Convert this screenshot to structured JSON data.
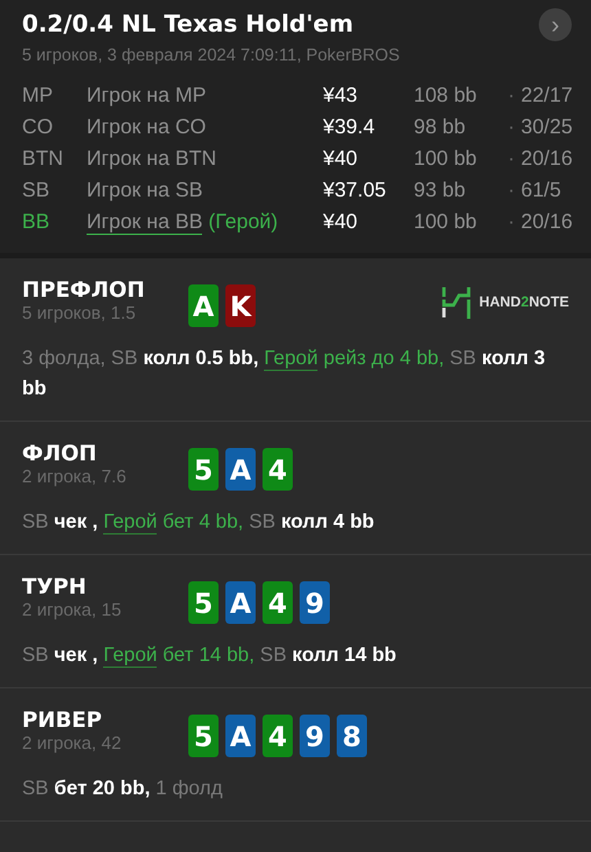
{
  "header": {
    "title": "0.2/0.4 NL Texas Hold'em",
    "subtitle": "5 игроков, 3 февраля 2024 7:09:11, PokerBROS",
    "next_button": "›"
  },
  "players": [
    {
      "position": "MP",
      "name": "Игрок на MP",
      "hero": false,
      "stack": "¥43",
      "bb": "108 bb",
      "separator": "·",
      "stats": "22/17"
    },
    {
      "position": "CO",
      "name": "Игрок на CO",
      "hero": false,
      "stack": "¥39.4",
      "bb": "98 bb",
      "separator": "·",
      "stats": "30/25"
    },
    {
      "position": "BTN",
      "name": "Игрок на BTN",
      "hero": false,
      "stack": "¥40",
      "bb": "100 bb",
      "separator": "·",
      "stats": "20/16"
    },
    {
      "position": "SB",
      "name": "Игрок на SB",
      "hero": false,
      "stack": "¥37.05",
      "bb": "93 bb",
      "separator": "·",
      "stats": "61/5"
    },
    {
      "position": "BB",
      "name": "Игрок на BB",
      "hero": true,
      "hero_tag": "(Герой)",
      "stack": "¥40",
      "bb": "100 bb",
      "separator": "·",
      "stats": "20/16"
    }
  ],
  "streets": [
    {
      "title": "ПРЕФЛОП",
      "info": "5 игроков, 1.5",
      "logo": {
        "before": "HAND",
        "highlight": "2",
        "after": "NOTE"
      },
      "cards": [
        {
          "rank": "A",
          "color": "#0f8a17"
        },
        {
          "rank": "K",
          "color": "#8c0c0c"
        }
      ],
      "actions": [
        {
          "kind": "muted",
          "text": "3 фолда, SB "
        },
        {
          "kind": "action",
          "text": "колл 0.5 bb, "
        },
        {
          "kind": "hero_link",
          "text": "Герой"
        },
        {
          "kind": "hero",
          "text": " рейз до 4 bb, "
        },
        {
          "kind": "muted",
          "text": "SB "
        },
        {
          "kind": "action",
          "text": "колл 3 bb"
        }
      ]
    },
    {
      "title": "ФЛОП",
      "info": "2 игрока, 7.6",
      "cards": [
        {
          "rank": "5",
          "color": "#0f8a17"
        },
        {
          "rank": "A",
          "color": "#1160a8"
        },
        {
          "rank": "4",
          "color": "#0f8a17"
        }
      ],
      "actions": [
        {
          "kind": "muted",
          "text": "SB "
        },
        {
          "kind": "action",
          "text": "чек , "
        },
        {
          "kind": "hero_link",
          "text": "Герой"
        },
        {
          "kind": "hero",
          "text": " бет 4 bb, "
        },
        {
          "kind": "muted",
          "text": "SB "
        },
        {
          "kind": "action",
          "text": "колл 4 bb"
        }
      ]
    },
    {
      "title": "ТУРН",
      "info": "2 игрока, 15",
      "cards": [
        {
          "rank": "5",
          "color": "#0f8a17"
        },
        {
          "rank": "A",
          "color": "#1160a8"
        },
        {
          "rank": "4",
          "color": "#0f8a17"
        },
        {
          "rank": "9",
          "color": "#1160a8"
        }
      ],
      "actions": [
        {
          "kind": "muted",
          "text": "SB "
        },
        {
          "kind": "action",
          "text": "чек , "
        },
        {
          "kind": "hero_link",
          "text": "Герой"
        },
        {
          "kind": "hero",
          "text": " бет 14 bb, "
        },
        {
          "kind": "muted",
          "text": "SB "
        },
        {
          "kind": "action",
          "text": "колл 14 bb"
        }
      ]
    },
    {
      "title": "РИВЕР",
      "info": "2 игрока, 42",
      "cards": [
        {
          "rank": "5",
          "color": "#0f8a17"
        },
        {
          "rank": "A",
          "color": "#1160a8"
        },
        {
          "rank": "4",
          "color": "#0f8a17"
        },
        {
          "rank": "9",
          "color": "#1160a8"
        },
        {
          "rank": "8",
          "color": "#1160a8"
        }
      ],
      "actions": [
        {
          "kind": "muted",
          "text": "SB "
        },
        {
          "kind": "action",
          "text": "бет 20 bb, "
        },
        {
          "kind": "muted",
          "text": "1 фолд"
        }
      ]
    }
  ]
}
